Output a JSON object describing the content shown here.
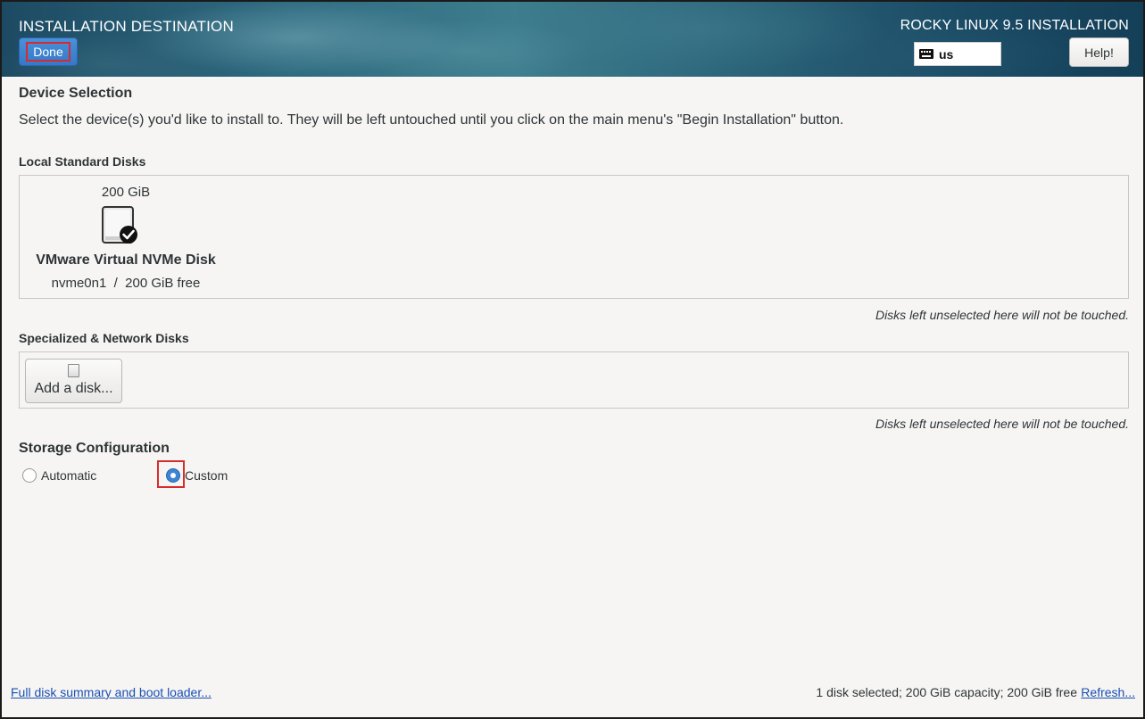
{
  "header": {
    "title": "INSTALLATION DESTINATION",
    "done_label": "Done",
    "distro_title": "ROCKY LINUX 9.5 INSTALLATION",
    "keyboard_layout": "us",
    "help_label": "Help!"
  },
  "device_selection": {
    "heading": "Device Selection",
    "intro": "Select the device(s) you'd like to install to.  They will be left untouched until you click on the main menu's \"Begin Installation\" button."
  },
  "local_disks": {
    "heading": "Local Standard Disks",
    "disks": [
      {
        "size": "200 GiB",
        "name": "VMware Virtual NVMe Disk",
        "details": "nvme0n1  /  200 GiB free",
        "selected": true,
        "icon": "hard-disk-selected-icon"
      }
    ],
    "hint": "Disks left unselected here will not be touched."
  },
  "network_disks": {
    "heading": "Specialized & Network Disks",
    "add_disk_label": "Add a disk...",
    "add_disk_icon": "disk-icon",
    "hint": "Disks left unselected here will not be touched."
  },
  "storage_config": {
    "heading": "Storage Configuration",
    "options": [
      {
        "label": "Automatic",
        "checked": false
      },
      {
        "label": "Custom",
        "checked": true
      }
    ]
  },
  "footer": {
    "summary_link": "Full disk summary and boot loader...",
    "status": "1 disk selected; 200 GiB capacity; 200 GiB free",
    "refresh_link": "Refresh..."
  },
  "colors": {
    "accent": "#3c85d4",
    "highlight": "#d62c2c",
    "link": "#1a4fb3",
    "background": "#f6f5f4"
  }
}
